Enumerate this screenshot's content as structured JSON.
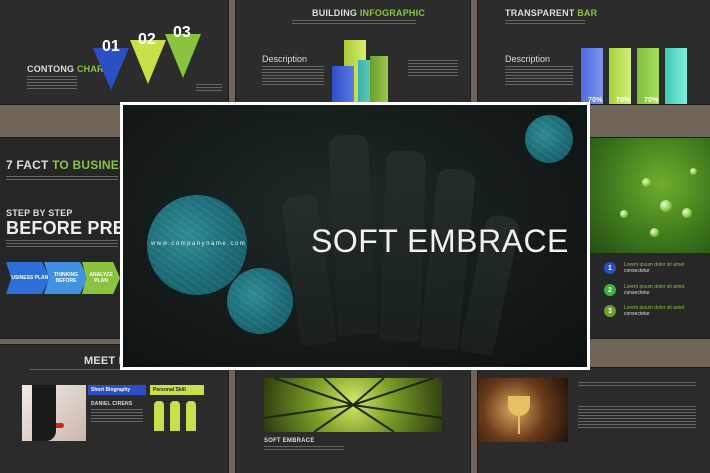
{
  "main": {
    "title": "SOFT EMBRACE",
    "url": "www.companyname.com"
  },
  "top_left": {
    "title_a": "CONTONG ",
    "title_b": "CHART",
    "numbers": [
      "01",
      "02",
      "03"
    ]
  },
  "top_center": {
    "title_a": "BUILDING ",
    "title_b": "INFOGRAPHIC",
    "desc_title": "Description"
  },
  "top_right": {
    "title_a": "TRANSPARENT ",
    "title_b": "BAR",
    "desc_title": "Description",
    "percents": [
      "70%",
      "70%",
      "70%"
    ]
  },
  "mid_left": {
    "fact_a": "7 FACT ",
    "fact_b": "TO BUSINESS",
    "step": "STEP BY STEP",
    "before": "BEFORE PRES",
    "chevrons": [
      "BUSINESS PLAN",
      "THINKING BEFORE",
      "ANALYZE PLAN"
    ]
  },
  "mid_right": {
    "steps": [
      {
        "n": "1",
        "a": "Lorem ipsum dolor sit amet",
        "b": "consectetur"
      },
      {
        "n": "2",
        "a": "Lorem ipsum dolor sit amet",
        "b": "consectetur"
      },
      {
        "n": "3",
        "a": "Lorem ipsum dolor sit amet",
        "b": "consectetur"
      }
    ]
  },
  "bottom_left": {
    "title": "MEET MA",
    "bio": "Short Biography",
    "name": "DANIEL CIRENS",
    "skill": "Personal Skill"
  },
  "bottom_center": {
    "title": "SOFT EMBRACE"
  },
  "colors": {
    "accent_green": "#8ac43f",
    "blue": "#2d4fc6",
    "teal": "#1c6c78"
  }
}
